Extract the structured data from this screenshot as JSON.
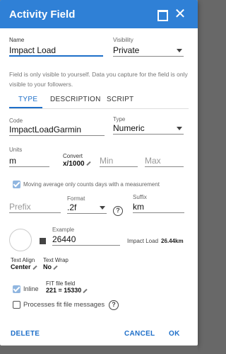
{
  "dialog": {
    "title": "Activity Field"
  },
  "name": {
    "label": "Name",
    "value": "Impact Load"
  },
  "visibility": {
    "label": "Visibility",
    "value": "Private"
  },
  "info_text": "Field is only visible to yourself. Data you capture for the field is only visible to your followers.",
  "tabs": [
    {
      "label": "TYPE",
      "active": true
    },
    {
      "label": "DESCRIPTION",
      "active": false
    },
    {
      "label": "SCRIPT",
      "active": false
    }
  ],
  "code": {
    "label": "Code",
    "value": "ImpactLoadGarmin"
  },
  "type": {
    "label": "Type",
    "value": "Numeric"
  },
  "units": {
    "label": "Units",
    "value": "m"
  },
  "convert": {
    "label": "Convert",
    "value": "x/1000"
  },
  "min": {
    "placeholder": "Min"
  },
  "max": {
    "placeholder": "Max"
  },
  "moving_average": {
    "label": "Moving average only counts days with a measurement",
    "checked": true
  },
  "prefix": {
    "placeholder": "Prefix"
  },
  "format": {
    "label": "Format",
    "value": ".2f"
  },
  "suffix": {
    "label": "Suffix",
    "value": "km"
  },
  "example": {
    "label": "Example",
    "value": "26440",
    "preview_name": "Impact Load",
    "preview_value": "26.44km"
  },
  "text_align": {
    "label": "Text Align",
    "value": "Center"
  },
  "text_wrap": {
    "label": "Text Wrap",
    "value": "No"
  },
  "inline": {
    "label": "Inline",
    "checked": true
  },
  "fit_file_field": {
    "label": "FIT file field",
    "value": "221 = 15330"
  },
  "processes_fit": {
    "label": "Processes fit file messages",
    "checked": false
  },
  "buttons": {
    "delete": "DELETE",
    "cancel": "CANCEL",
    "ok": "OK"
  },
  "colors": {
    "accent": "#2f80d6",
    "link": "#1e6fc9",
    "checkbox_on": "#90b6e0"
  },
  "icons": {
    "maximize": "maximize-icon",
    "close": "close-icon",
    "help": "help-circle-icon",
    "edit": "pencil-icon"
  }
}
